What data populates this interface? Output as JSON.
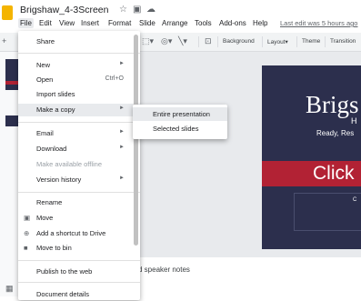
{
  "app": {
    "title": "Brigshaw_4-3Screen",
    "title_icons": [
      "star-icon",
      "folder-icon",
      "cloud-icon"
    ],
    "last_edit": "Last edit was 5 hours ago"
  },
  "menubar": [
    "File",
    "Edit",
    "View",
    "Insert",
    "Format",
    "Slide",
    "Arrange",
    "Tools",
    "Add-ons",
    "Help"
  ],
  "toolbar": {
    "background_label": "Background",
    "layout_label": "Layout▾",
    "theme_label": "Theme",
    "transition_label": "Transition"
  },
  "file_menu": {
    "share": "Share",
    "new": "New",
    "open": "Open",
    "open_shortcut": "Ctrl+O",
    "import_slides": "Import slides",
    "make_copy": "Make a copy",
    "email": "Email",
    "download": "Download",
    "make_available_offline": "Make available offline",
    "version_history": "Version history",
    "rename": "Rename",
    "move": "Move",
    "add_shortcut": "Add a shortcut to Drive",
    "move_to_bin": "Move to bin",
    "publish": "Publish to the web",
    "document_details": "Document details"
  },
  "copy_submenu": {
    "entire": "Entire presentation",
    "selected": "Selected slides"
  },
  "slide": {
    "title": "Brigs",
    "line_h": "H",
    "subtitle": "Ready, Res",
    "click": "Click",
    "small": "C"
  },
  "speaker_notes": "d speaker notes",
  "colors": {
    "slide_navy": "#2c2f4d",
    "accent_red": "#b22234",
    "menu_highlight": "#e8eaed"
  }
}
